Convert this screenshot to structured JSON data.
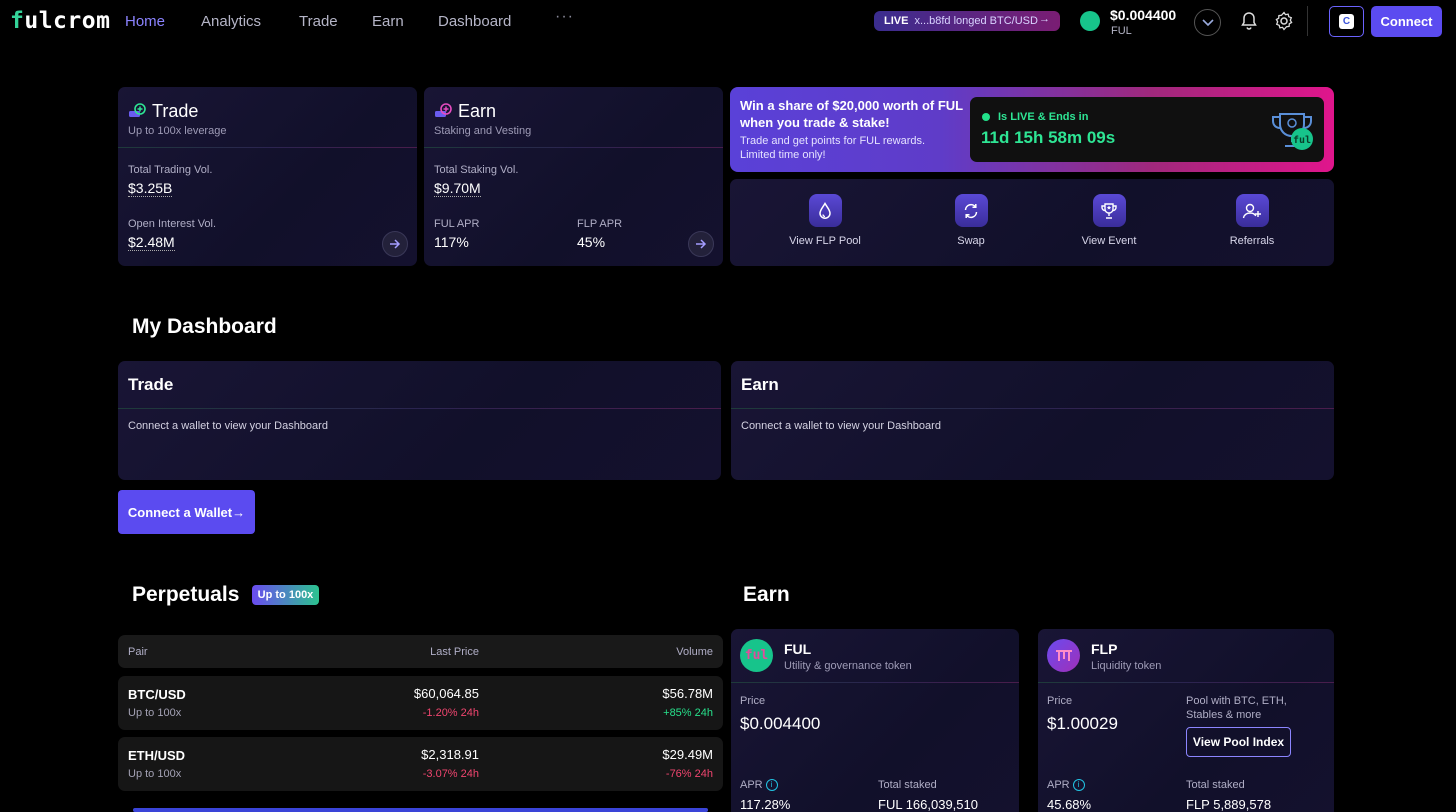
{
  "nav": {
    "logo": {
      "first": "f",
      "rest": "ulcrom"
    },
    "links": [
      "Home",
      "Analytics",
      "Trade",
      "Earn",
      "Dashboard"
    ],
    "more": "···",
    "live_label": "LIVE",
    "live_text": "x...b8fd longed BTC/USD",
    "live_arrow": "→",
    "token_price": "$0.004400",
    "token_symbol": "FUL",
    "connect_label": "Connect",
    "c_icon": "C"
  },
  "trade_card": {
    "title": "Trade",
    "subtitle": "Up to 100x leverage",
    "total_label": "Total Trading Vol.",
    "total_value": "$3.25B",
    "oi_label": "Open Interest Vol.",
    "oi_value": "$2.48M"
  },
  "earn_card": {
    "title": "Earn",
    "subtitle": "Staking and Vesting",
    "total_label": "Total Staking Vol.",
    "total_value": "$9.70M",
    "ful_apr_label": "FUL APR",
    "ful_apr_value": "117%",
    "flp_apr_label": "FLP APR",
    "flp_apr_value": "45%"
  },
  "promo": {
    "title": "Win a share of $20,000 worth of FUL when you trade & stake!",
    "subtitle": "Trade and get points for FUL rewards. Limited time only!",
    "live_text": "Is LIVE & Ends in",
    "countdown": "11d 15h 58m 09s",
    "trophy_badge": "ful"
  },
  "quick_actions": [
    {
      "label": "View FLP Pool",
      "icon": "drop-icon"
    },
    {
      "label": "Swap",
      "icon": "swap-icon"
    },
    {
      "label": "View Event",
      "icon": "trophy-icon"
    },
    {
      "label": "Referrals",
      "icon": "add-user-icon"
    }
  ],
  "dashboard": {
    "title": "My Dashboard",
    "trade_title": "Trade",
    "trade_text": "Connect a wallet to view your Dashboard",
    "earn_title": "Earn",
    "earn_text": "Connect a wallet to view your Dashboard",
    "connect_label": "Connect a Wallet→"
  },
  "perpetuals": {
    "title": "Perpetuals",
    "badge": "Up to 100x",
    "headers": {
      "pair": "Pair",
      "last_price": "Last Price",
      "volume": "Volume"
    },
    "rows": [
      {
        "pair": "BTC/USD",
        "leverage": "Up to 100x",
        "price": "$60,064.85",
        "price_change": "-1.20% 24h",
        "volume": "$56.78M",
        "volume_change": "+85% 24h"
      },
      {
        "pair": "ETH/USD",
        "leverage": "Up to 100x",
        "price": "$2,318.91",
        "price_change": "-3.07% 24h",
        "volume": "$29.49M",
        "volume_change": "-76% 24h"
      }
    ]
  },
  "earn_section": {
    "title": "Earn",
    "ful": {
      "name": "FUL",
      "desc": "Utility & governance token",
      "icon_text": "ful",
      "price_label": "Price",
      "price": "$0.004400",
      "apr_label": "APR",
      "apr": "117.28%",
      "staked_label": "Total staked",
      "staked": "FUL 166,039,510"
    },
    "flp": {
      "name": "FLP",
      "desc": "Liquidity token",
      "price_label": "Price",
      "price": "$1.00029",
      "pool_desc": "Pool with BTC, ETH, Stables & more",
      "button": "View Pool Index",
      "apr_label": "APR",
      "apr": "45.68%",
      "staked_label": "Total staked",
      "staked": "FLP 5,889,578"
    },
    "info_glyph": "i"
  },
  "colors": {
    "accent": "#5b4bf0",
    "green": "#27e08b",
    "red": "#f0456f",
    "link_active": "#8b83ff"
  }
}
